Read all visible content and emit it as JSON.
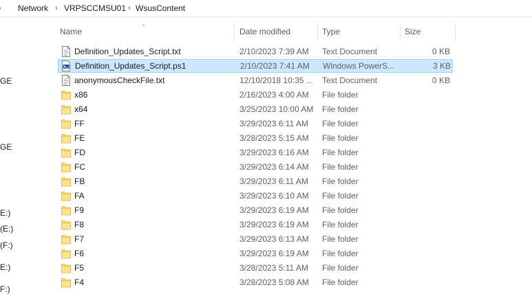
{
  "address_bar": {
    "crumbs": [
      "Network",
      "VRPSCCMSU01",
      "WsusContent"
    ]
  },
  "nav_pane": {
    "labels": [
      "GE",
      "GE",
      "E:)",
      "(E:)",
      "(F:)",
      "E:)",
      "F:)"
    ]
  },
  "columns": {
    "name": "Name",
    "date_modified": "Date modified",
    "type": "Type",
    "size": "Size"
  },
  "files": [
    {
      "name": "Definition_Updates_Script.txt",
      "date": "2/10/2023 7:39 AM",
      "type": "Text Document",
      "size": "0 KB",
      "icon": "text-document-icon",
      "selected": false
    },
    {
      "name": "Definition_Updates_Script.ps1",
      "date": "2/10/2023 7:41 AM",
      "type": "Windows PowerS...",
      "size": "3 KB",
      "icon": "powershell-script-icon",
      "selected": true
    },
    {
      "name": "anonymousCheckFile.txt",
      "date": "12/10/2018 10:35 ...",
      "type": "Text Document",
      "size": "0 KB",
      "icon": "text-document-icon",
      "selected": false
    },
    {
      "name": "x86",
      "date": "2/16/2023 4:00 AM",
      "type": "File folder",
      "size": "",
      "icon": "folder-icon",
      "selected": false
    },
    {
      "name": "x64",
      "date": "3/25/2023 10:00 AM",
      "type": "File folder",
      "size": "",
      "icon": "folder-icon",
      "selected": false
    },
    {
      "name": "FF",
      "date": "3/29/2023 6:11 AM",
      "type": "File folder",
      "size": "",
      "icon": "folder-icon",
      "selected": false
    },
    {
      "name": "FE",
      "date": "3/28/2023 5:15 AM",
      "type": "File folder",
      "size": "",
      "icon": "folder-icon",
      "selected": false
    },
    {
      "name": "FD",
      "date": "3/29/2023 6:16 AM",
      "type": "File folder",
      "size": "",
      "icon": "folder-icon",
      "selected": false
    },
    {
      "name": "FC",
      "date": "3/29/2023 6:14 AM",
      "type": "File folder",
      "size": "",
      "icon": "folder-icon",
      "selected": false
    },
    {
      "name": "FB",
      "date": "3/29/2023 6:11 AM",
      "type": "File folder",
      "size": "",
      "icon": "folder-icon",
      "selected": false
    },
    {
      "name": "FA",
      "date": "3/29/2023 6:10 AM",
      "type": "File folder",
      "size": "",
      "icon": "folder-icon",
      "selected": false
    },
    {
      "name": "F9",
      "date": "3/29/2023 6:19 AM",
      "type": "File folder",
      "size": "",
      "icon": "folder-icon",
      "selected": false
    },
    {
      "name": "F8",
      "date": "3/29/2023 6:19 AM",
      "type": "File folder",
      "size": "",
      "icon": "folder-icon",
      "selected": false
    },
    {
      "name": "F7",
      "date": "3/29/2023 6:13 AM",
      "type": "File folder",
      "size": "",
      "icon": "folder-icon",
      "selected": false
    },
    {
      "name": "F6",
      "date": "3/29/2023 6:19 AM",
      "type": "File folder",
      "size": "",
      "icon": "folder-icon",
      "selected": false
    },
    {
      "name": "F5",
      "date": "3/28/2023 5:11 AM",
      "type": "File folder",
      "size": "",
      "icon": "folder-icon",
      "selected": false
    },
    {
      "name": "F4",
      "date": "3/28/2023 5:08 AM",
      "type": "File folder",
      "size": "",
      "icon": "folder-icon",
      "selected": false
    }
  ],
  "colors": {
    "selection_fill": "#cce8ff",
    "selection_border": "#99d1ff",
    "folder_yellow": "#ffd766",
    "header_text": "#4c607a"
  }
}
